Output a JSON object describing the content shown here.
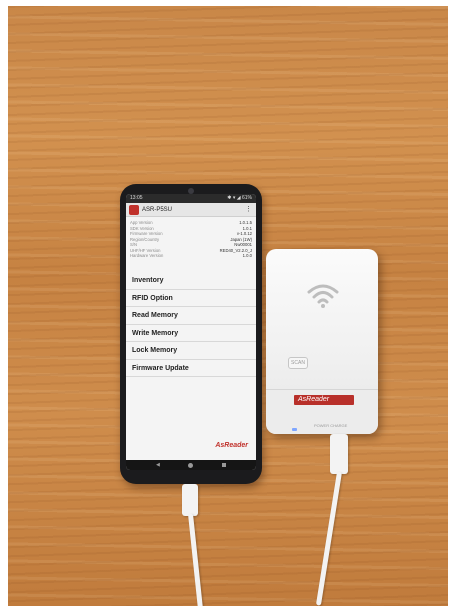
{
  "phone": {
    "status_time": "13:05",
    "status_icons": "✱ ▾ ◢ 61%",
    "app_title": "ASR-P5SU",
    "menu_icon": "⋮",
    "info": [
      {
        "label": "App Version",
        "value": "1.0.1.5"
      },
      {
        "label": "SDK Version",
        "value": "1.0.1"
      },
      {
        "label": "Firmware Version",
        "value": "v-1.0.12"
      },
      {
        "label": "Region/Country",
        "value": "Japan (1W)"
      },
      {
        "label": "S/N",
        "value": "Nw00001"
      },
      {
        "label": "UHF/HF Version",
        "value": "RED40_V2.2.0_J"
      },
      {
        "label": "Hardware Version",
        "value": "1.0.0"
      }
    ],
    "menu": [
      "Inventory",
      "RFID Option",
      "Read Memory",
      "Write Memory",
      "Lock Memory",
      "Firmware Update"
    ],
    "brand": "AsReader",
    "nav_back": "◀"
  },
  "reader": {
    "scan_label": "SCAN",
    "logo_text": "AsReader",
    "labels": "POWER  CHARGE"
  }
}
